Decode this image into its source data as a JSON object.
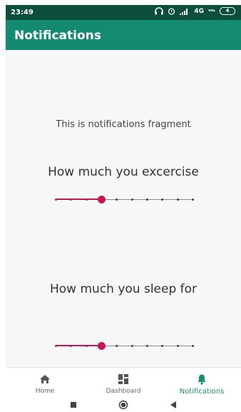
{
  "status_bar": {
    "time": "23:49",
    "network": "4G",
    "volte": "VoLTE",
    "battery": "4"
  },
  "app_bar": {
    "title": "Notifications"
  },
  "content": {
    "fragment_text": "This is notifications fragment",
    "exercise": {
      "question": "How much you excercise",
      "slider_steps": 10,
      "slider_value": 3
    },
    "sleep": {
      "question": "How much you sleep for",
      "slider_steps": 10,
      "slider_value": 3
    }
  },
  "bottom_nav": {
    "items": [
      {
        "label": "Home",
        "icon": "home-icon",
        "active": false
      },
      {
        "label": "Dashboard",
        "icon": "dashboard-icon",
        "active": false
      },
      {
        "label": "Notifications",
        "icon": "bell-icon",
        "active": true
      }
    ]
  },
  "colors": {
    "primary": "#148a71",
    "primary_dark": "#0b4e3c",
    "accent": "#c2185b"
  }
}
